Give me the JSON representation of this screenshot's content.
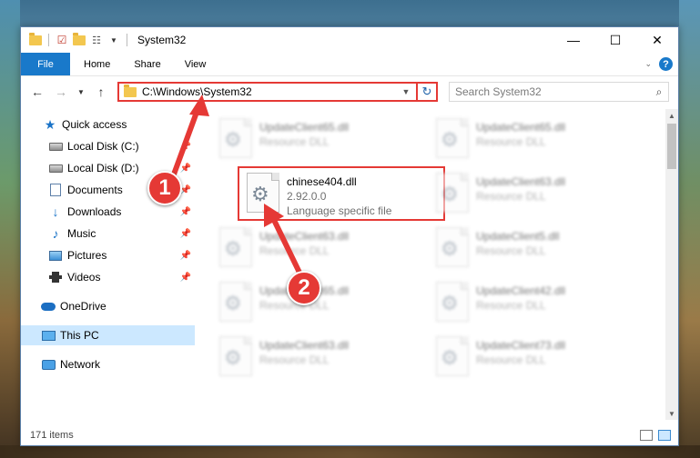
{
  "window": {
    "title": "System32",
    "controls": {
      "minimize": "—",
      "maximize": "☐",
      "close": "✕"
    }
  },
  "ribbon": {
    "tabs": [
      "File",
      "Home",
      "Share",
      "View"
    ],
    "help": "?",
    "expand_icon": "chevron-down-icon"
  },
  "navigation": {
    "address": "C:\\Windows\\System32",
    "search_placeholder": "Search System32"
  },
  "sidebar": {
    "items": [
      {
        "label": "Quick access",
        "icon": "star-icon",
        "pinned": false
      },
      {
        "label": "Local Disk (C:)",
        "icon": "drive-icon",
        "pinned": true
      },
      {
        "label": "Local Disk (D:)",
        "icon": "drive-icon",
        "pinned": true
      },
      {
        "label": "Documents",
        "icon": "documents-icon",
        "pinned": true
      },
      {
        "label": "Downloads",
        "icon": "downloads-icon",
        "pinned": true
      },
      {
        "label": "Music",
        "icon": "music-icon",
        "pinned": true
      },
      {
        "label": "Pictures",
        "icon": "pictures-icon",
        "pinned": true
      },
      {
        "label": "Videos",
        "icon": "videos-icon",
        "pinned": true
      },
      {
        "label": "OneDrive",
        "icon": "onedrive-icon",
        "pinned": false
      },
      {
        "label": "This PC",
        "icon": "pc-icon",
        "pinned": false,
        "selected": true
      },
      {
        "label": "Network",
        "icon": "network-icon",
        "pinned": false
      }
    ]
  },
  "files": {
    "left_column": [
      {
        "name": "UpdateClient65.dll",
        "sub": "Resource DLL"
      },
      {
        "name": "chinese404.dll",
        "sub": "2.92.0.0",
        "sub2": "Language specific file",
        "highlighted": true
      },
      {
        "name": "UpdateClient63.dll",
        "sub": "Resource DLL"
      },
      {
        "name": "UpdateClient65.dll",
        "sub": "Resource DLL"
      },
      {
        "name": "UpdateClient63.dll",
        "sub": "Resource DLL"
      }
    ],
    "right_column": [
      {
        "name": "UpdateClient65.dll",
        "sub": "Resource DLL"
      },
      {
        "name": "UpdateClient63.dll",
        "sub": "Resource DLL"
      },
      {
        "name": "UpdateClient5.dll",
        "sub": "Resource DLL"
      },
      {
        "name": "UpdateClient42.dll",
        "sub": "Resource DLL"
      },
      {
        "name": "UpdateClient73.dll",
        "sub": "Resource DLL"
      }
    ]
  },
  "status": {
    "item_count": "171 items"
  },
  "annotations": {
    "step1": "1",
    "step2": "2",
    "color": "#e53935"
  }
}
